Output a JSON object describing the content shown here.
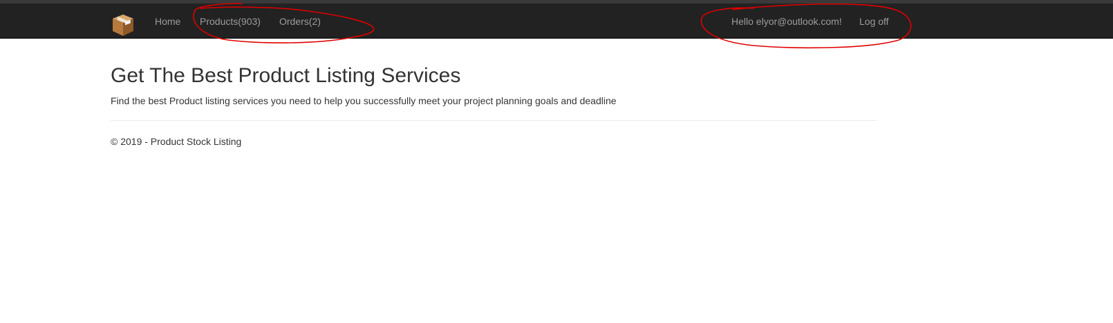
{
  "nav": {
    "brand_icon": "package-box-icon",
    "home": "Home",
    "products": "Products(903)",
    "orders": "Orders(2)",
    "greeting": "Hello elyor@outlook.com!",
    "logoff": "Log off"
  },
  "main": {
    "title": "Get The Best Product Listing Services",
    "lead": "Find the best Product listing services you need to help you successfully meet your project planning goals and deadline"
  },
  "footer": {
    "text": "© 2019 - Product Stock Listing"
  },
  "colors": {
    "navbar_bg": "#222222",
    "nav_link": "#9d9d9d",
    "annotation_red": "#e00000",
    "text": "#333333"
  }
}
